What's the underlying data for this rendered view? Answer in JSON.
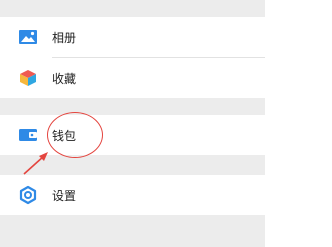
{
  "menu": {
    "items": [
      {
        "id": "album",
        "label": "相册",
        "icon": "image-icon",
        "color": "#2f8ae6"
      },
      {
        "id": "favorites",
        "label": "收藏",
        "icon": "cube-icon",
        "color": "#f2a03d"
      },
      {
        "id": "wallet",
        "label": "钱包",
        "icon": "wallet-icon",
        "color": "#2f8ae6"
      },
      {
        "id": "settings",
        "label": "设置",
        "icon": "gear-icon",
        "color": "#2f8ae6"
      }
    ]
  },
  "annotation": {
    "color": "#e4453f"
  }
}
